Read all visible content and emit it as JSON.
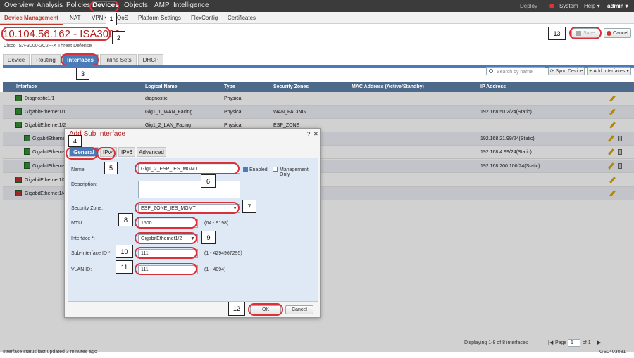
{
  "topnav": {
    "items": [
      "Overview",
      "Analysis",
      "Policies",
      "Devices",
      "Objects",
      "AMP",
      "Intelligence"
    ],
    "deploy": "Deploy",
    "system": "System",
    "help": "Help ▾",
    "user": "admin ▾"
  },
  "subnav": {
    "items": [
      "Device Management",
      "NAT",
      "VPN ▾",
      "QoS",
      "Platform Settings",
      "FlexConfig",
      "Certificates"
    ]
  },
  "device": {
    "title": "10.104.56.162 - ISA3000",
    "subtitle": "Cisco ISA-3000-2C2F-X Threat Defense"
  },
  "actions": {
    "save": "Save",
    "cancel": "Cancel"
  },
  "tabs": [
    "Device",
    "Routing",
    "Interfaces",
    "Inline Sets",
    "DHCP"
  ],
  "toolbar": {
    "search_placeholder": "Search by name",
    "sync": "Sync Device",
    "add": "Add Interfaces ▾"
  },
  "table": {
    "headers": [
      "Interface",
      "Logical Name",
      "Type",
      "Security Zones",
      "MAC Address (Active/Standby)",
      "IP Address"
    ],
    "rows": [
      [
        "Diagnostic1/1",
        "diagnostic",
        "Physical",
        "",
        "",
        ""
      ],
      [
        "GigabitEthernet1/1",
        "Gig1_1_WAN_Facing",
        "Physical",
        "WAN_FACING",
        "",
        "192.168.50.2/24(Static)"
      ],
      [
        "GigabitEthernet1/2",
        "Gig1_2_LAN_Facing",
        "Physical",
        "ESP_ZONE",
        "",
        ""
      ],
      [
        "GigabitEthernet1/2",
        "",
        "",
        "",
        "",
        "192.168.21.99/24(Static)"
      ],
      [
        "GigabitEthernet1/2",
        "",
        "",
        "",
        "",
        "192.168.4.99/24(Static)"
      ],
      [
        "GigabitEthernet1/2",
        "",
        "",
        "",
        "",
        "192.168.200.100/24(Static)"
      ],
      [
        "GigabitEthernet1/3",
        "",
        "",
        "",
        "",
        ""
      ],
      [
        "GigabitEthernet1/4",
        "",
        "",
        "",
        "",
        ""
      ]
    ]
  },
  "dialog": {
    "title": "Add Sub Interface",
    "help": "?",
    "close": "✕",
    "tabs": [
      "General",
      "IPv4",
      "IPv6",
      "Advanced"
    ],
    "name_label": "Name:",
    "name_value": "Gig1_2_ESP_IES_MGMT",
    "enabled_label": "Enabled",
    "mgmt_label": "Management Only",
    "desc_label": "Description:",
    "zone_label": "Security Zone:",
    "zone_value": "ESP_ZONE_IES_MGMT",
    "mtu_label": "MTU:",
    "mtu_value": "1500",
    "mtu_hint": "(64 - 9198)",
    "iface_label": "Interface *:",
    "iface_value": "GigabitEthernet1/2",
    "subid_label": "Sub-Interface ID *:",
    "subid_value": "111",
    "subid_hint": "(1 - 4294967295)",
    "vlan_label": "VLAN ID:",
    "vlan_value": "111",
    "vlan_hint": "(1 - 4094)",
    "ok": "OK",
    "cancel": "Cancel"
  },
  "annotations": [
    "1",
    "2",
    "3",
    "4",
    "5",
    "6",
    "7",
    "8",
    "9",
    "10",
    "11",
    "12",
    "13"
  ],
  "status": "Interface status last updated 3 minutes ago",
  "pager": {
    "text": "Displaying 1-8 of 8 interfaces",
    "page_label": "Page",
    "page": "1",
    "of": "of 1"
  },
  "figure_id": "GS0403031"
}
